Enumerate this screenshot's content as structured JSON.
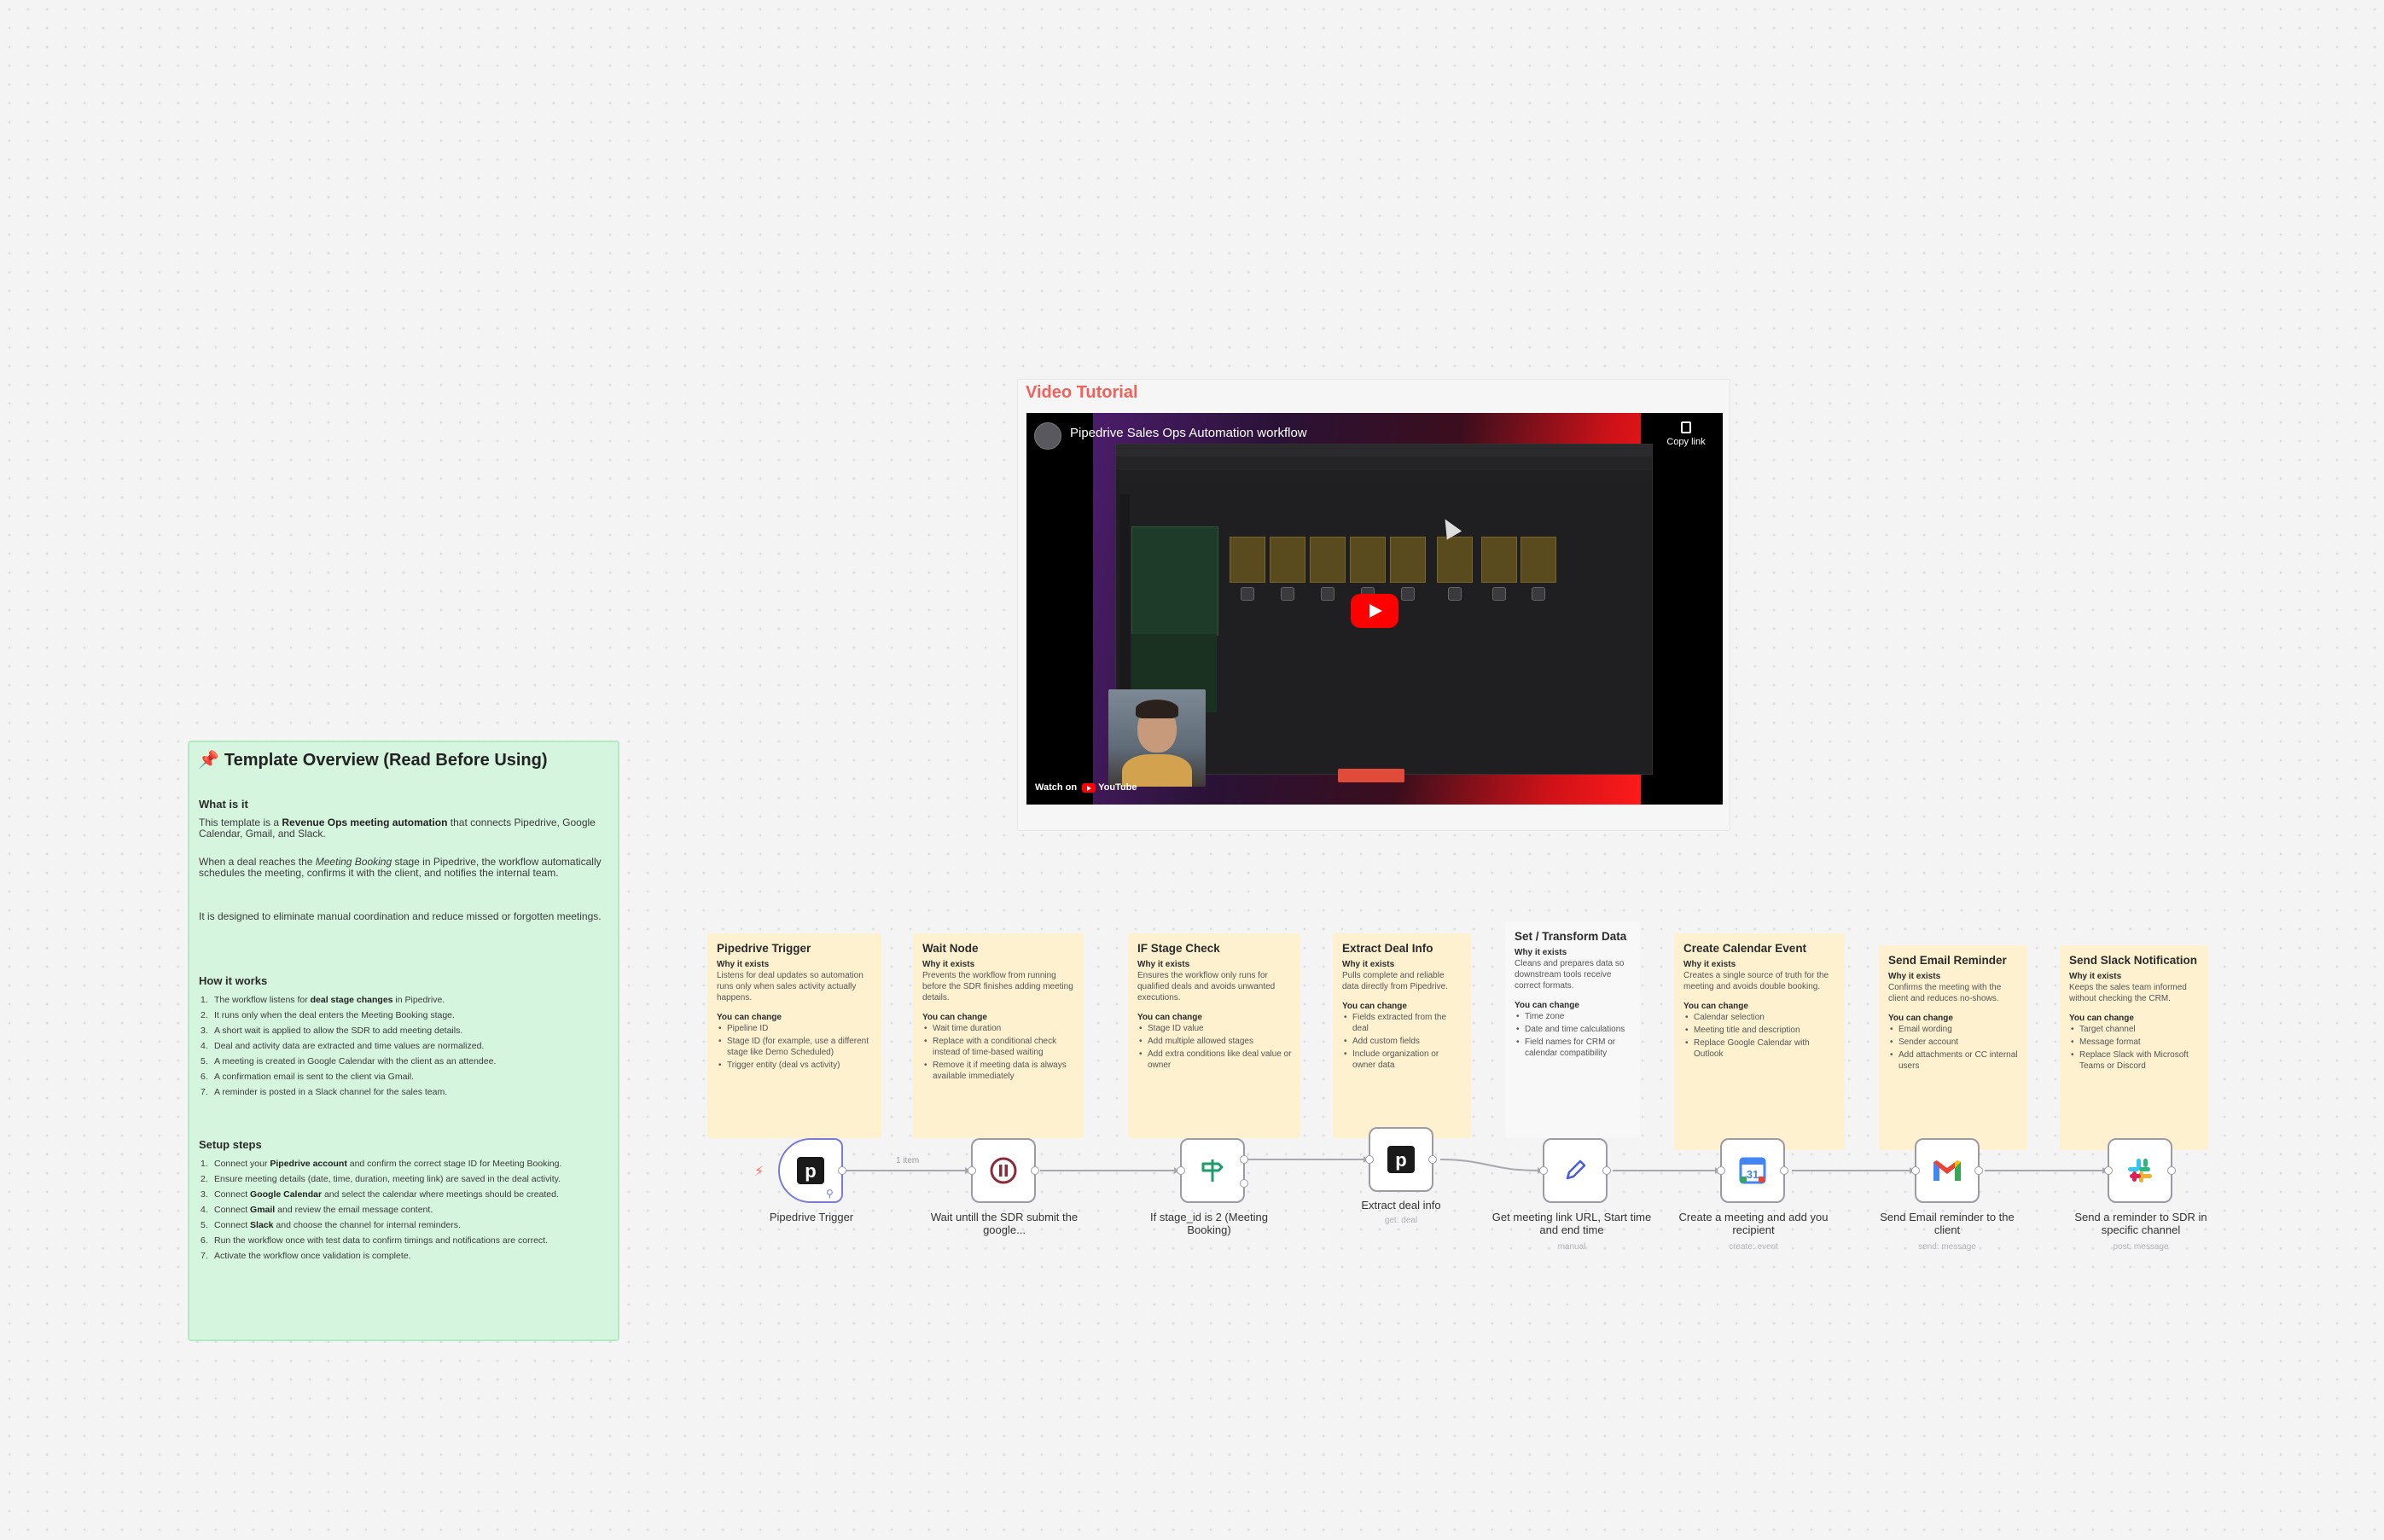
{
  "overview": {
    "title": "Template Overview (Read Before Using)",
    "what_heading": "What is it",
    "what_p1_a": "This template is a ",
    "what_p1_b": "Revenue Ops meeting automation",
    "what_p1_c": " that connects Pipedrive, Google Calendar, Gmail, and Slack.",
    "what_p2_a": "When a deal reaches the ",
    "what_p2_b": "Meeting Booking",
    "what_p2_c": " stage in Pipedrive, the workflow automatically schedules the meeting, confirms it with the client, and notifies the internal team.",
    "what_p3": "It is designed to eliminate manual coordination and reduce missed or forgotten meetings.",
    "how_heading": "How it works",
    "how": [
      {
        "n": "1.",
        "a": "The workflow listens for ",
        "b": "deal stage changes",
        "c": " in Pipedrive."
      },
      {
        "n": "2.",
        "a": "It runs only when the deal enters the Meeting Booking stage.",
        "b": "",
        "c": ""
      },
      {
        "n": "3.",
        "a": "A short wait is applied to allow the SDR to add meeting details.",
        "b": "",
        "c": ""
      },
      {
        "n": "4.",
        "a": "Deal and activity data are extracted and time values are normalized.",
        "b": "",
        "c": ""
      },
      {
        "n": "5.",
        "a": "A meeting is created in Google Calendar with the client as an attendee.",
        "b": "",
        "c": ""
      },
      {
        "n": "6.",
        "a": "A confirmation email is sent to the client via Gmail.",
        "b": "",
        "c": ""
      },
      {
        "n": "7.",
        "a": "A reminder is posted in a Slack channel for the sales team.",
        "b": "",
        "c": ""
      }
    ],
    "setup_heading": "Setup steps",
    "setup": [
      {
        "n": "1.",
        "a": "Connect your ",
        "b": "Pipedrive account",
        "c": " and confirm the correct stage ID for Meeting Booking."
      },
      {
        "n": "2.",
        "a": "Ensure meeting details (date, time, duration, meeting link) are saved in the deal activity.",
        "b": "",
        "c": ""
      },
      {
        "n": "3.",
        "a": "Connect ",
        "b": "Google Calendar",
        "c": " and select the calendar where meetings should be created."
      },
      {
        "n": "4.",
        "a": "Connect ",
        "b": "Gmail",
        "c": " and review the email message content."
      },
      {
        "n": "5.",
        "a": "Connect ",
        "b": "Slack",
        "c": " and choose the channel for internal reminders."
      },
      {
        "n": "6.",
        "a": "Run the workflow once with test data to confirm timings and notifications are correct.",
        "b": "",
        "c": ""
      },
      {
        "n": "7.",
        "a": "Activate the workflow once validation is complete.",
        "b": "",
        "c": ""
      }
    ]
  },
  "video": {
    "section_title": "Video Tutorial",
    "title": "Pipedrive Sales Ops Automation workflow",
    "copy_link": "Copy link",
    "watch_on": "Watch on",
    "youtube": "YouTube"
  },
  "notes": [
    {
      "title": "Pipedrive Trigger",
      "why_h": "Why it exists",
      "why": "Listens for deal updates so automation runs only when sales activity actually happens.",
      "change_h": "You can change",
      "items": [
        "Pipeline ID",
        "Stage ID (for example, use a different stage like Demo Scheduled)",
        "Trigger entity (deal vs activity)"
      ]
    },
    {
      "title": "Wait Node",
      "why_h": "Why it exists",
      "why": "Prevents the workflow from running before the SDR finishes adding meeting details.",
      "change_h": "You can change",
      "items": [
        "Wait time duration",
        "Replace with a conditional check instead of time-based waiting",
        "Remove it if meeting data is always available immediately"
      ]
    },
    {
      "title": "IF Stage Check",
      "why_h": "Why it exists",
      "why": "Ensures the workflow only runs for qualified deals and avoids unwanted executions.",
      "change_h": "You can change",
      "items": [
        "Stage ID value",
        "Add multiple allowed stages",
        "Add extra conditions like deal value or owner"
      ]
    },
    {
      "title": "Extract Deal Info",
      "why_h": "Why it exists",
      "why": "Pulls complete and reliable data directly from Pipedrive.",
      "change_h": "You can change",
      "items": [
        "Fields extracted from the deal",
        "Add custom fields",
        "Include organization or owner data"
      ]
    },
    {
      "title": "Set / Transform Data",
      "why_h": "Why it exists",
      "why": "Cleans and prepares data so downstream tools receive correct formats.",
      "change_h": "You can change",
      "items": [
        "Time zone",
        "Date and time calculations",
        "Field names for CRM or calendar compatibility"
      ]
    },
    {
      "title": "Create Calendar Event",
      "why_h": "Why it exists",
      "why": "Creates a single source of truth for the meeting and avoids double booking.",
      "change_h": "You can change",
      "items": [
        "Calendar selection",
        "Meeting title and description",
        "Replace Google Calendar with Outlook"
      ]
    },
    {
      "title": "Send Email Reminder",
      "why_h": "Why it exists",
      "why": "Confirms the meeting with the client and reduces no-shows.",
      "change_h": "You can change",
      "items": [
        "Email wording",
        "Sender account",
        "Add attachments or CC internal users"
      ]
    },
    {
      "title": "Send Slack Notification",
      "why_h": "Why it exists",
      "why": "Keeps the sales team informed without checking the CRM.",
      "change_h": "You can change",
      "items": [
        "Target channel",
        "Message format",
        "Replace Slack with Microsoft Teams or Discord"
      ]
    }
  ],
  "nodes": [
    {
      "label": "Pipedrive Trigger",
      "op": ""
    },
    {
      "label": "Wait untill the SDR submit the google...",
      "op": ""
    },
    {
      "label": "If stage_id is 2 (Meeting Booking)",
      "op": ""
    },
    {
      "label": "Extract deal info",
      "op": "get: deal"
    },
    {
      "label": "Get meeting link URL, Start time and end time",
      "op": "manual"
    },
    {
      "label": "Create a meeting and add you recipient",
      "op": "create: event"
    },
    {
      "label": "Send Email reminder to the client",
      "op": "send: message"
    },
    {
      "label": "Send a reminder to SDR in specific channel",
      "op": "post: message"
    }
  ],
  "edges": {
    "first_label": "1 item"
  },
  "colors": {
    "accent": "#ff6d5a",
    "sticky_yellow": "#fdf1cf",
    "sticky_green": "#d6f5df",
    "video_title": "#f1605a"
  }
}
